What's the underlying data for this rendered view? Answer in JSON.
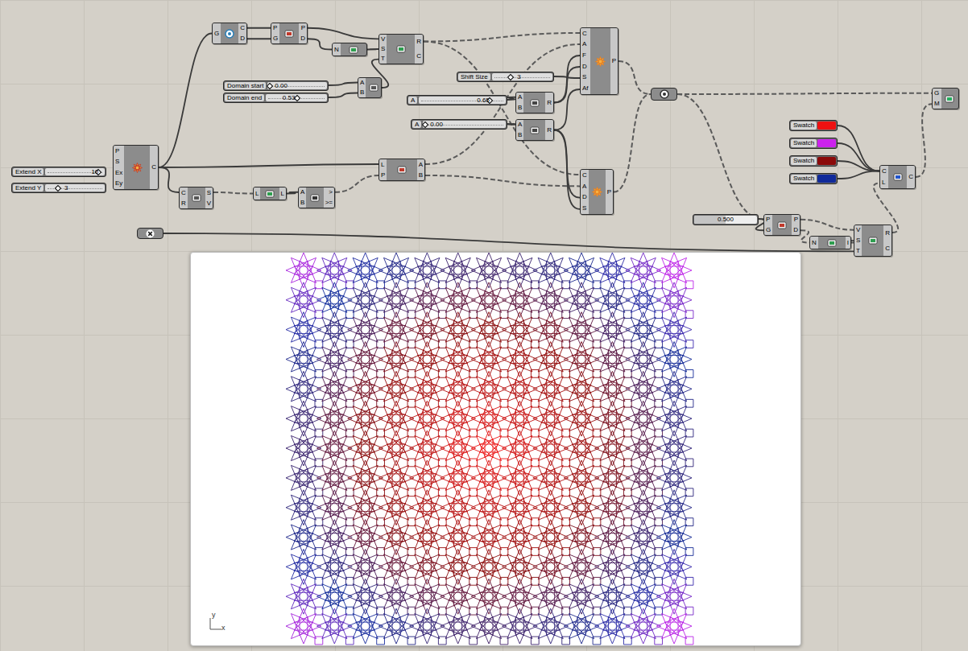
{
  "components": [
    {
      "kind": "component",
      "inputs": [
        "G"
      ],
      "outputs": [
        "C",
        "D"
      ]
    },
    {
      "kind": "component",
      "inputs": [
        "P",
        "G"
      ],
      "outputs": [
        "P",
        "D"
      ]
    },
    {
      "kind": "component",
      "inputs": [
        "N"
      ],
      "outputs": []
    },
    {
      "kind": "component",
      "inputs": [
        "V",
        "S",
        "T"
      ],
      "outputs": [
        "R",
        "C"
      ]
    },
    {
      "kind": "component",
      "inputs": [
        "A",
        "B"
      ],
      "outputs": []
    },
    {
      "kind": "component",
      "inputs": [
        "A",
        "B"
      ],
      "outputs": [
        "R"
      ]
    },
    {
      "kind": "component",
      "inputs": [
        "A",
        "B"
      ],
      "outputs": [
        "R"
      ]
    },
    {
      "kind": "component",
      "inputs": [
        "C",
        "A",
        "F",
        "D",
        "S",
        "Af"
      ],
      "outputs": [
        "P"
      ]
    },
    {
      "kind": "component",
      "inputs": [
        "C",
        "A",
        "D",
        "S"
      ],
      "outputs": [
        "P"
      ]
    },
    {
      "kind": "param",
      "inputs": [],
      "outputs": []
    },
    {
      "kind": "component",
      "inputs": [
        "G",
        "M"
      ],
      "outputs": []
    },
    {
      "kind": "component",
      "inputs": [
        "C",
        "L"
      ],
      "outputs": [
        "C"
      ]
    },
    {
      "kind": "component",
      "inputs": [
        "P",
        "G"
      ],
      "outputs": [
        "P",
        "D"
      ]
    },
    {
      "kind": "component",
      "inputs": [
        "N"
      ],
      "outputs": [
        "I"
      ]
    },
    {
      "kind": "component",
      "inputs": [
        "V",
        "S",
        "T"
      ],
      "outputs": [
        "R",
        "C"
      ]
    },
    {
      "kind": "component",
      "inputs": [
        "P",
        "S",
        "Ex",
        "Ey"
      ],
      "outputs": [
        "C"
      ]
    },
    {
      "kind": "component",
      "inputs": [
        "C",
        "R"
      ],
      "outputs": [
        "S",
        "V"
      ]
    },
    {
      "kind": "component",
      "inputs": [
        "L"
      ],
      "outputs": [
        "L"
      ]
    },
    {
      "kind": "component",
      "inputs": [
        "A",
        "B"
      ],
      "outputs": [
        ">",
        ">="
      ]
    },
    {
      "kind": "component",
      "inputs": [
        "L",
        "P"
      ],
      "outputs": [
        "A",
        "B"
      ]
    },
    {
      "kind": "param",
      "inputs": [],
      "outputs": []
    }
  ],
  "sliders": [
    {
      "kind": "slider",
      "label": "Domain start",
      "value": "0.00",
      "level": 0.0
    },
    {
      "kind": "slider",
      "label": "Domain end",
      "value": "0.53",
      "level": 0.53
    },
    {
      "kind": "slider",
      "label": "Shift Size",
      "value": "3",
      "level": 0.3
    },
    {
      "kind": "slider",
      "label": "A",
      "value": "0.65",
      "level": 0.85
    },
    {
      "kind": "slider",
      "label": "A",
      "value": "0.00",
      "level": 0.0
    },
    {
      "kind": "slider",
      "label": "Extend X",
      "value": "10",
      "level": 0.95
    },
    {
      "kind": "slider",
      "label": "Extend Y",
      "value": "3",
      "level": 0.2
    },
    {
      "kind": "bar",
      "value": "0.500",
      "level": 0.5
    }
  ],
  "swatches": [
    {
      "label": "Swatch",
      "color": "#ee1111"
    },
    {
      "label": "Swatch",
      "color": "#cc22ee"
    },
    {
      "label": "Swatch",
      "color": "#8b0a0a"
    },
    {
      "label": "Swatch",
      "color": "#102a9a"
    }
  ],
  "viewport": {
    "axis_labels": [
      "y",
      "x"
    ]
  }
}
